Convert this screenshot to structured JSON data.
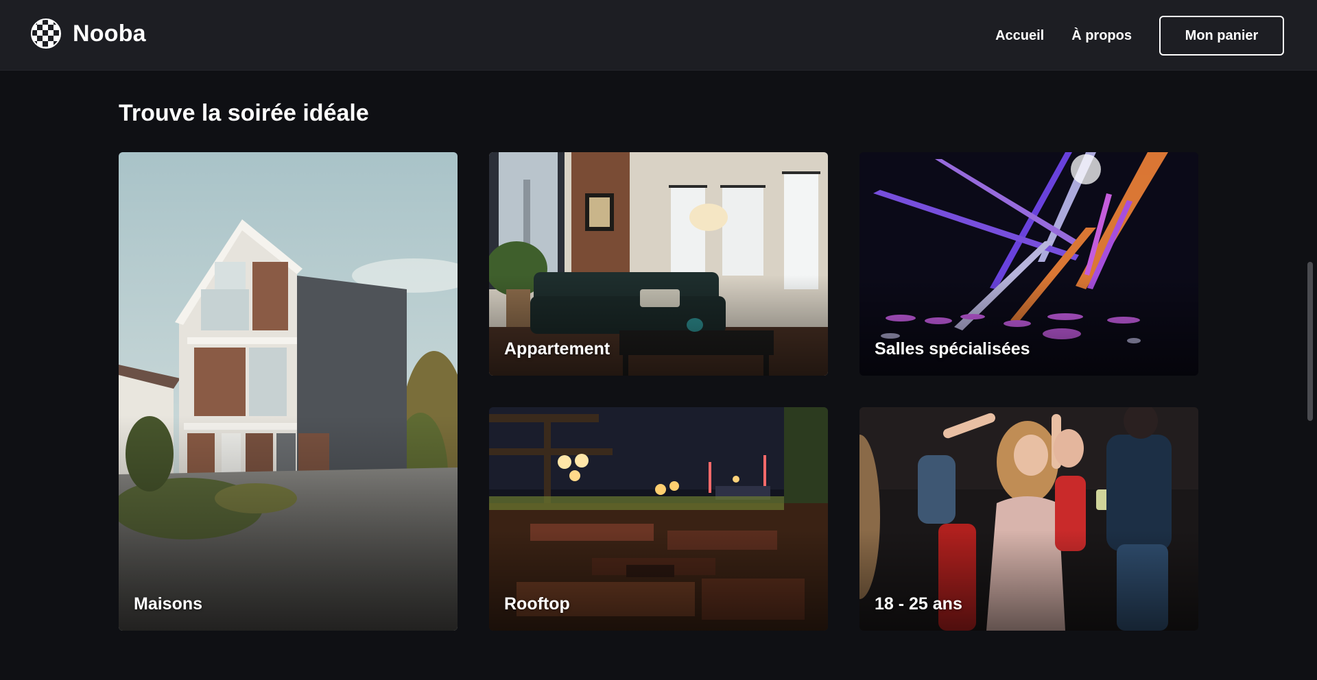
{
  "header": {
    "brand_name": "Nooba",
    "nav": {
      "home_label": "Accueil",
      "about_label": "À propos",
      "cart_label": "Mon panier"
    }
  },
  "main": {
    "title": "Trouve la soirée idéale",
    "cards": [
      {
        "label": "Maisons"
      },
      {
        "label": "Appartement"
      },
      {
        "label": "Salles spécialisées"
      },
      {
        "label": "Rooftop"
      },
      {
        "label": "18 - 25 ans"
      }
    ]
  },
  "colors": {
    "page_background": "#0f1014",
    "header_background": "#1d1e23",
    "text": "#ffffff"
  }
}
